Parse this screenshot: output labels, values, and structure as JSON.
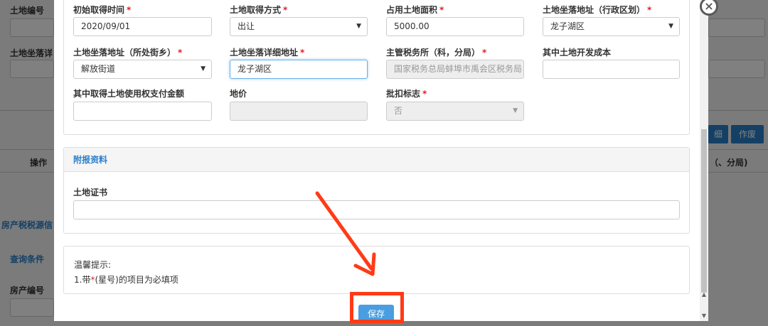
{
  "background": {
    "land_no_label": "土地编号",
    "land_addr_label": "土地坐落详",
    "op_col": "操作",
    "col_right": "（、分局)",
    "btn_detail": "细",
    "btn_void": "作废",
    "house_section": "房产税税源信",
    "query_title": "查询条件",
    "house_no_label": "房产编号"
  },
  "form": {
    "acquire_time": {
      "label": "初始取得时间",
      "value": "2020/09/01"
    },
    "acquire_method": {
      "label": "土地取得方式",
      "value": "出让"
    },
    "area": {
      "label": "占用土地面积",
      "value": "5000.00"
    },
    "district": {
      "label": "土地坐落地址（行政区划）",
      "value": "龙子湖区"
    },
    "township": {
      "label": "土地坐落地址（所处街乡）",
      "value": "解放街道"
    },
    "detail_addr": {
      "label": "土地坐落详细地址",
      "value": "龙子湖区"
    },
    "tax_office": {
      "label": "主管税务所（科，分局）",
      "value": "国家税务总局蚌埠市禹会区税务局"
    },
    "dev_cost": {
      "label": "其中土地开发成本",
      "value": ""
    },
    "use_right_fee": {
      "label": "其中取得土地使用权支付金额",
      "value": ""
    },
    "land_price": {
      "label": "地价",
      "value": ""
    },
    "approval": {
      "label": "批扣标志",
      "value": "否"
    }
  },
  "attachments": {
    "title": "附报资料",
    "cert_label": "土地证书",
    "cert_value": ""
  },
  "hint": {
    "title": "温馨提示:",
    "line_prefix": "1.带",
    "star": "*",
    "line_suffix": "(星号)的项目为必填项"
  },
  "save_label": "保存",
  "close_glyph": "×",
  "required_color": "#e02020",
  "accent_color": "#2a7fc9",
  "highlight_color": "#ff3b16"
}
